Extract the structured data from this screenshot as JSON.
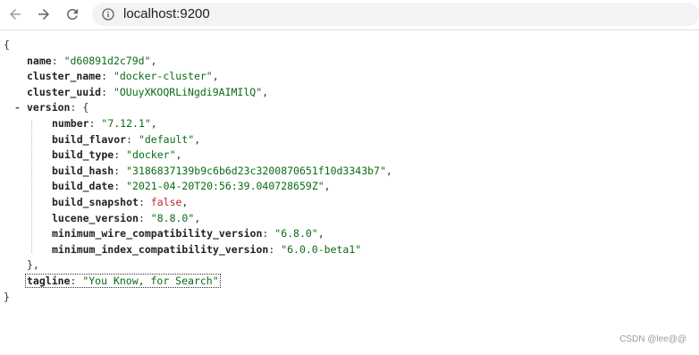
{
  "browser": {
    "url": "localhost:9200",
    "icons": {
      "back": "back-arrow-icon",
      "forward": "forward-arrow-icon",
      "reload": "reload-icon",
      "info": "info-icon"
    }
  },
  "json_view": {
    "open_brace": "{",
    "close_brace": "}",
    "collapse_toggle": "-",
    "fields": {
      "name": {
        "key": "name",
        "value": "\"d60891d2c79d\""
      },
      "cluster_name": {
        "key": "cluster_name",
        "value": "\"docker-cluster\""
      },
      "cluster_uuid": {
        "key": "cluster_uuid",
        "value": "\"OUuyXKOQRLiNgdi9AIMIlQ\""
      },
      "version": {
        "key": "version",
        "open": "{",
        "close": "},"
      },
      "tagline": {
        "key": "tagline",
        "value": "\"You Know, for Search\""
      }
    },
    "version_fields": [
      {
        "key": "number",
        "value": "\"7.12.1\"",
        "type": "string"
      },
      {
        "key": "build_flavor",
        "value": "\"default\"",
        "type": "string"
      },
      {
        "key": "build_type",
        "value": "\"docker\"",
        "type": "string"
      },
      {
        "key": "build_hash",
        "value": "\"3186837139b9c6b6d23c3200870651f10d3343b7\"",
        "type": "string"
      },
      {
        "key": "build_date",
        "value": "\"2021-04-20T20:56:39.040728659Z\"",
        "type": "string"
      },
      {
        "key": "build_snapshot",
        "value": "false",
        "type": "boolean"
      },
      {
        "key": "lucene_version",
        "value": "\"8.8.0\"",
        "type": "string"
      },
      {
        "key": "minimum_wire_compatibility_version",
        "value": "\"6.8.0\"",
        "type": "string"
      },
      {
        "key": "minimum_index_compatibility_version",
        "value": "\"6.0.0-beta1\"",
        "type": "string"
      }
    ]
  },
  "watermark": "CSDN @lee@@",
  "colors": {
    "string": "#0b6b17",
    "boolean": "#c1272d",
    "key": "#222222",
    "address_bar": "#f1f3f4"
  }
}
